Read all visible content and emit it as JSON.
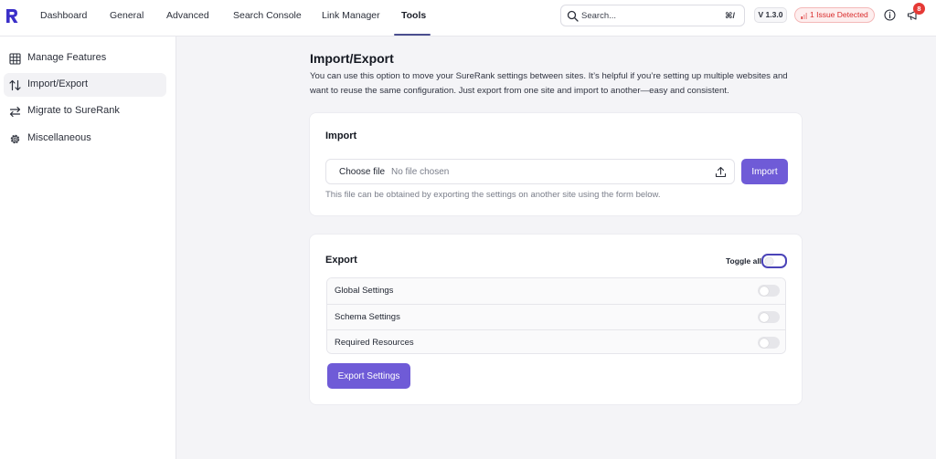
{
  "topbar": {
    "nav": [
      {
        "label": "Dashboard",
        "active": false
      },
      {
        "label": "General",
        "active": false
      },
      {
        "label": "Advanced",
        "active": false
      },
      {
        "label": "Search Console",
        "active": false
      },
      {
        "label": "Link Manager",
        "active": false
      },
      {
        "label": "Tools",
        "active": true
      }
    ],
    "search": {
      "placeholder": "Search...",
      "shortcut": "⌘/"
    },
    "version": "V 1.3.0",
    "issues": "1 Issue Detected",
    "notification_count": "8"
  },
  "sidebar": {
    "items": [
      {
        "label": "Manage Features",
        "icon": "grid-icon",
        "active": false
      },
      {
        "label": "Import/Export",
        "icon": "sort-arrows-icon",
        "active": true
      },
      {
        "label": "Migrate to SureRank",
        "icon": "swap-arrows-icon",
        "active": false
      },
      {
        "label": "Miscellaneous",
        "icon": "gear-icon",
        "active": false
      }
    ]
  },
  "main": {
    "title": "Import/Export",
    "description": "You can use this option to move your SureRank settings between sites. It’s helpful if you’re setting up multiple websites and want to reuse the same configuration. Just export from one site and import to another—easy and consistent.",
    "import": {
      "title": "Import",
      "choose_file": "Choose file",
      "no_file": "No file chosen",
      "button": "Import",
      "help": "This file can be obtained by exporting the settings on another site using the form below."
    },
    "export": {
      "title": "Export",
      "toggle_all_label": "Toggle all",
      "settings": [
        {
          "label": "Global Settings",
          "enabled": false
        },
        {
          "label": "Schema Settings",
          "enabled": false
        },
        {
          "label": "Required Resources",
          "enabled": false
        }
      ],
      "button": "Export Settings"
    }
  },
  "colors": {
    "accent": "#6f5bd7",
    "brand_logo": "#3b2fc9",
    "issue_red": "#d92d2d",
    "toggle_all_outline": "#4b44b8"
  }
}
